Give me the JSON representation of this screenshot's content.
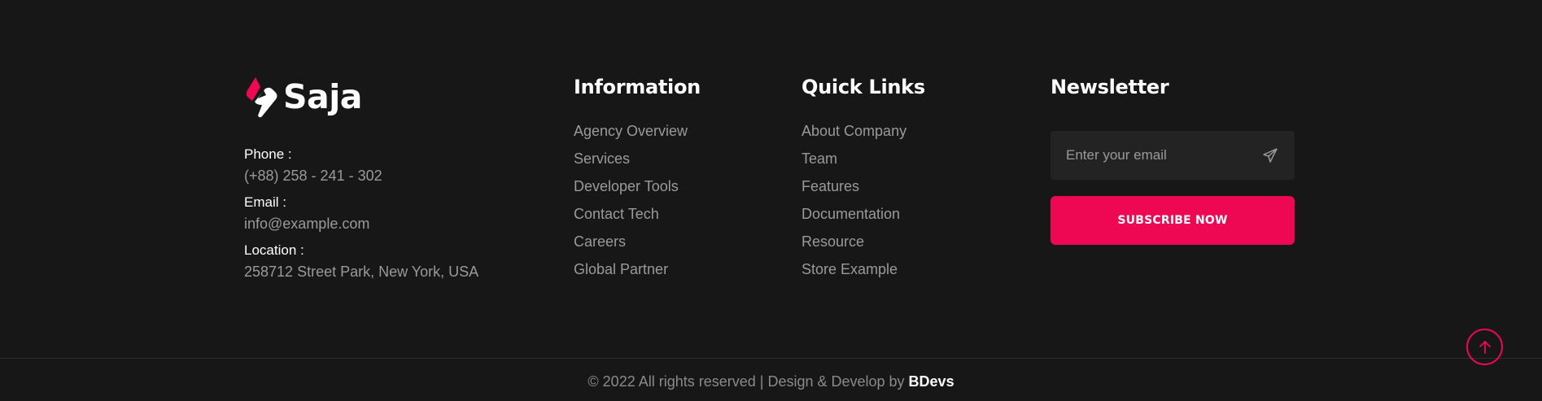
{
  "brand": {
    "name": "Saja"
  },
  "contact": {
    "phone_label": "Phone :",
    "phone_value": "(+88) 258 - 241 - 302",
    "email_label": "Email :",
    "email_value": "info@example.com",
    "location_label": "Location :",
    "location_value": "258712 Street Park, New York, USA"
  },
  "information": {
    "title": "Information",
    "links": [
      "Agency Overview",
      "Services",
      "Developer Tools",
      "Contact Tech",
      "Careers",
      "Global Partner"
    ]
  },
  "quick_links": {
    "title": "Quick Links",
    "links": [
      "About Company",
      "Team",
      "Features",
      "Documentation",
      "Resource",
      "Store Example"
    ]
  },
  "newsletter": {
    "title": "Newsletter",
    "email_placeholder": "Enter your email",
    "send_icon": "paper-plane-icon",
    "subscribe_label": "SUBSCRIBE NOW"
  },
  "footer_bottom": {
    "copyright_prefix": "© 2022 All rights reserved | Design & Develop by ",
    "brand": "BDevs",
    "scroll_top_icon": "arrow-up-icon"
  },
  "colors": {
    "background": "#171717",
    "accent": "#ee0853",
    "input_bg": "#232323",
    "muted_text": "#9a9a9a",
    "heading_text": "#ffffff"
  }
}
